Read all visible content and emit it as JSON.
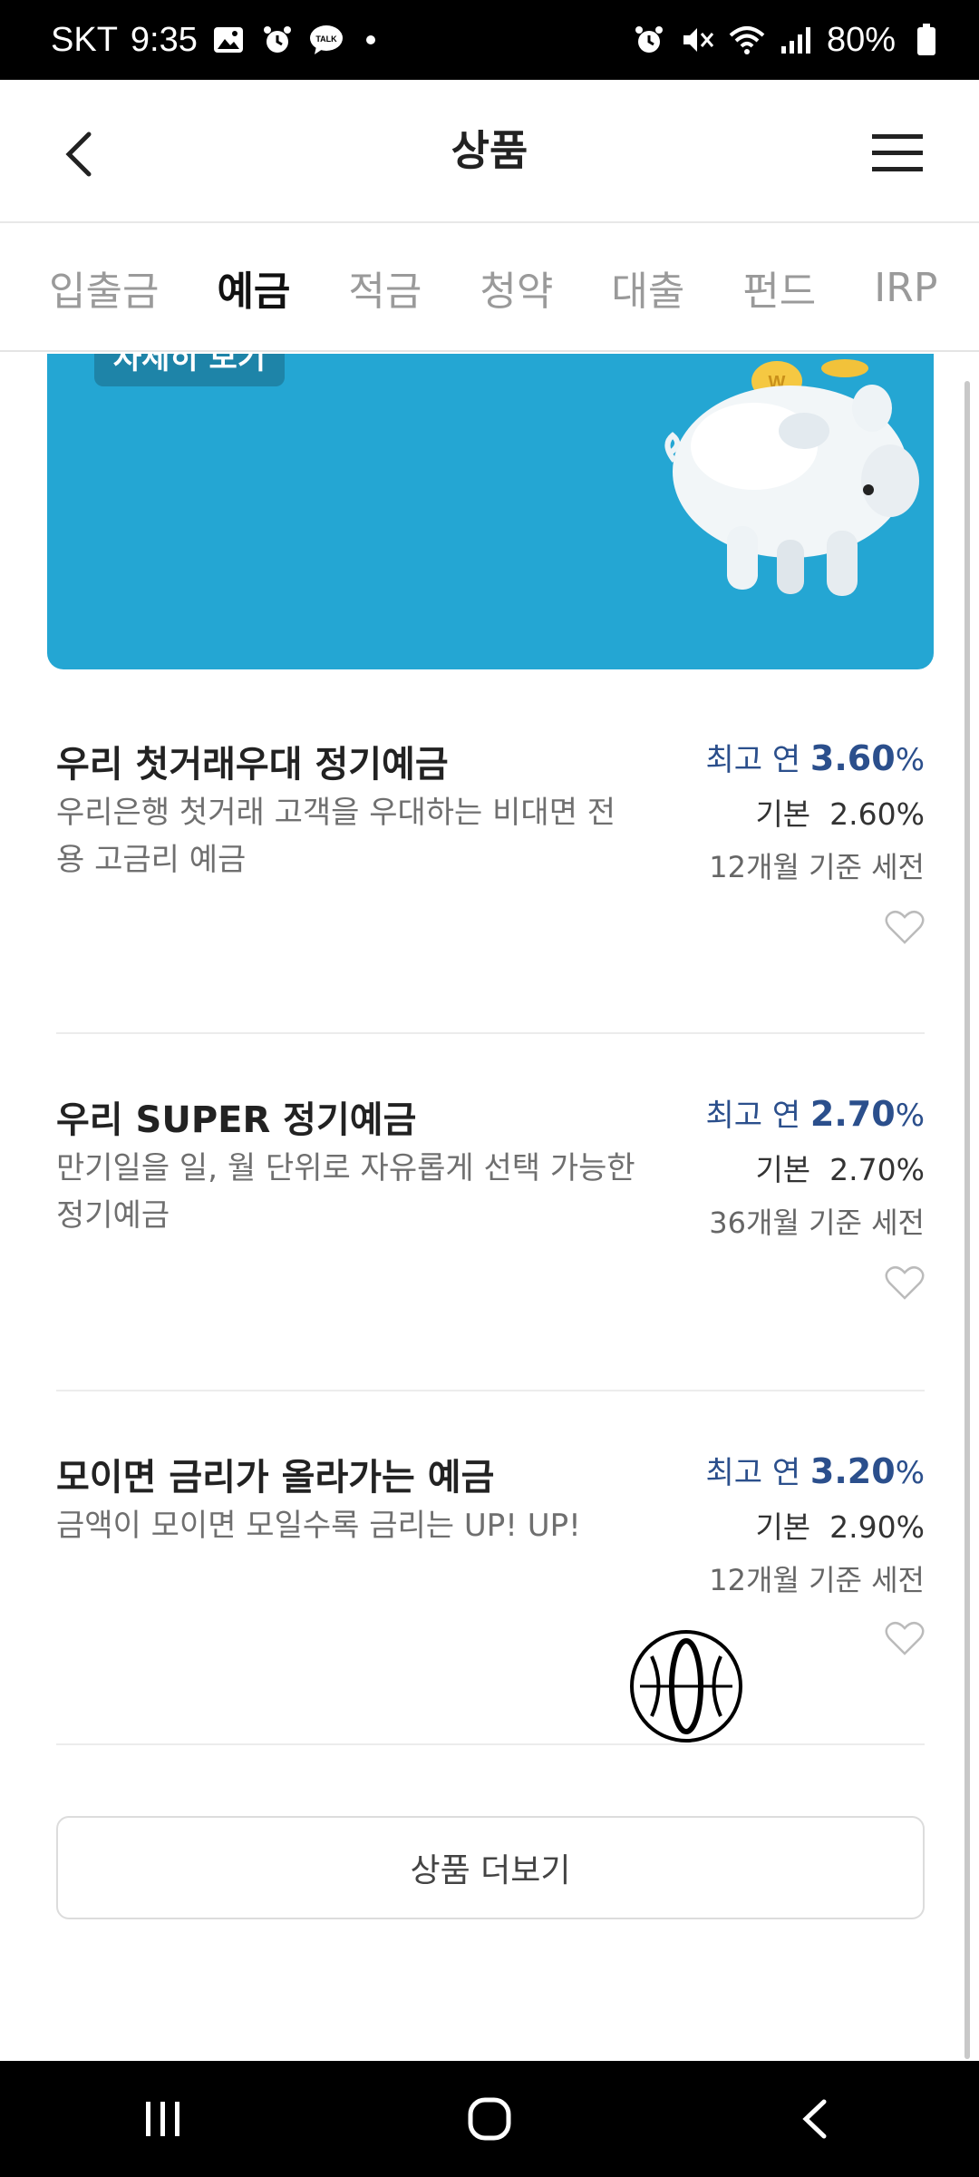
{
  "status_bar": {
    "carrier": "SKT",
    "time": "9:35",
    "battery": "80%"
  },
  "header": {
    "title": "상품"
  },
  "tabs": [
    {
      "label": "입출금",
      "active": false
    },
    {
      "label": "예금",
      "active": true
    },
    {
      "label": "적금",
      "active": false
    },
    {
      "label": "청약",
      "active": false
    },
    {
      "label": "대출",
      "active": false
    },
    {
      "label": "펀드",
      "active": false
    },
    {
      "label": "IRP",
      "active": false
    }
  ],
  "banner": {
    "button_label": "자세히 보기"
  },
  "products": [
    {
      "name": "우리 첫거래우대 정기예금",
      "desc": "우리은행 첫거래 고객을 우대하는 비대면 전용 고금리 예금",
      "max_prefix": "최고 연",
      "max_rate": "3.60",
      "base_label": "기본",
      "base_rate": "2.60",
      "term": "12개월 기준 세전"
    },
    {
      "name": "우리 SUPER 정기예금",
      "desc": "만기일을 일, 월 단위로 자유롭게 선택 가능한 정기예금",
      "max_prefix": "최고 연",
      "max_rate": "2.70",
      "base_label": "기본",
      "base_rate": "2.70",
      "term": "36개월 기준 세전"
    },
    {
      "name": "모이면 금리가 올라가는 예금",
      "desc": "금액이 모이면 모일수록 금리는 UP! UP!",
      "max_prefix": "최고 연",
      "max_rate": "3.20",
      "base_label": "기본",
      "base_rate": "2.90",
      "term": "12개월 기준 세전"
    }
  ],
  "percent": "%",
  "more_button": "상품 더보기",
  "colors": {
    "accent": "#2b4f8c",
    "banner": "#24a6d3"
  }
}
